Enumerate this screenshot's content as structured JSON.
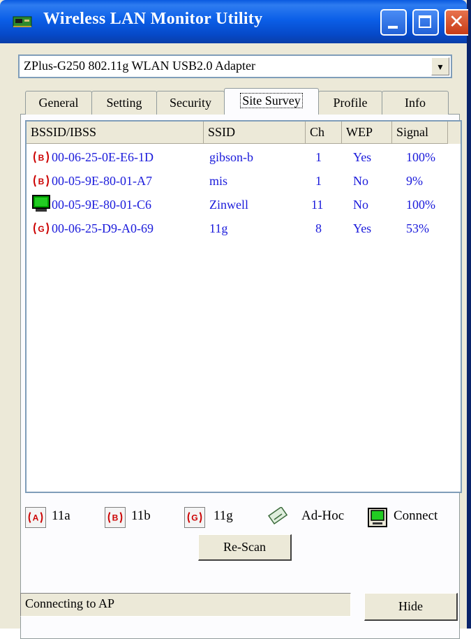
{
  "window": {
    "title": "Wireless LAN Monitor Utility"
  },
  "adapter": {
    "selected": "ZPlus-G250 802.11g WLAN USB2.0 Adapter"
  },
  "tabs": [
    {
      "label": "General"
    },
    {
      "label": "Setting"
    },
    {
      "label": "Security"
    },
    {
      "label": "Site Survey",
      "active": true
    },
    {
      "label": "Profile"
    },
    {
      "label": "Info"
    }
  ],
  "table": {
    "columns": [
      "BSSID/IBSS",
      "SSID",
      "Ch",
      "WEP",
      "Signal"
    ],
    "rows": [
      {
        "type_icon": "b-badge-icon",
        "bssid": "00-06-25-0E-E6-1D",
        "ssid": "gibson-b",
        "ch": "1",
        "wep": "Yes",
        "signal": "100%"
      },
      {
        "type_icon": "b-badge-icon",
        "bssid": "00-05-9E-80-01-A7",
        "ssid": "mis",
        "ch": "1",
        "wep": "No",
        "signal": "9%"
      },
      {
        "type_icon": "connect-icon",
        "bssid": "00-05-9E-80-01-C6",
        "ssid": "Zinwell",
        "ch": "11",
        "wep": "No",
        "signal": "100%"
      },
      {
        "type_icon": "g-badge-icon",
        "bssid": "00-06-25-D9-A0-69",
        "ssid": "11g",
        "ch": "8",
        "wep": "Yes",
        "signal": "53%"
      }
    ]
  },
  "legend": {
    "a": "11a",
    "b": "11b",
    "g": "11g",
    "adhoc": "Ad-Hoc",
    "connect": "Connect",
    "a_badge": "A",
    "b_badge": "B",
    "g_badge": "G"
  },
  "buttons": {
    "rescan": "Re-Scan",
    "hide": "Hide"
  },
  "status": {
    "text": "Connecting to AP"
  },
  "colors": {
    "title_bar": "#0b5fe8",
    "row_text": "#1a1adb",
    "badge_red": "#cc0000",
    "connect_green": "#00a000"
  }
}
